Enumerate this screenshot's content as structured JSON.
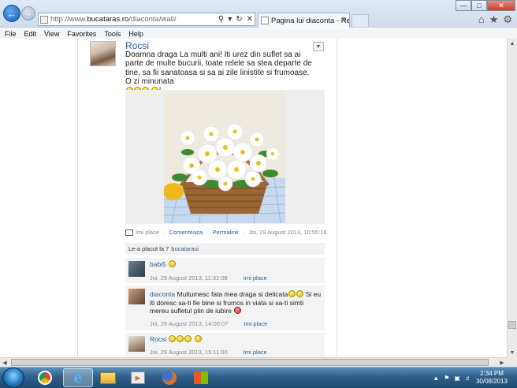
{
  "browser": {
    "url_prefix": "http://www.",
    "url_domain": "bucataras.ro",
    "url_path": "/diaconta/wall/",
    "tab_title": "Pagina lui diaconta - Retete...",
    "menu": [
      "File",
      "Edit",
      "View",
      "Favorites",
      "Tools",
      "Help"
    ]
  },
  "post": {
    "author": "Rocsi",
    "text": "Doamna draga La multi ani! Iti urez din suflet sa ai parte de multe bucurii, toate relele sa stea departe de tine, sa fii sanatoasa si sa ai zile linistite si frumoase. O zi minunata",
    "like_label": "Imi place",
    "comment_label": "Comenteaza",
    "permalink_label": "Permalink",
    "timestamp": "Joi, 29 August 2013, 10:55:16"
  },
  "likes": {
    "prefix": "Le-a placut la 7",
    "link": "bucatarasi"
  },
  "comments": [
    {
      "author": "babi5",
      "text": "",
      "timestamp": "Joi, 29 August 2013, 11:32:08",
      "like_label": "Imi place"
    },
    {
      "author": "diaconta",
      "text": "Multumesc fata mea draga si delicata",
      "text2": "Si eu iti doresc sa-ti fie bine si frumos in viata si sa-ti simti mereu sufletul plin de iubire",
      "timestamp": "Joi, 29 August 2013, 14:00:07",
      "like_label": "Imi place"
    },
    {
      "author": "Rocsi",
      "text": "",
      "timestamp": "Joi, 29 August 2013, 15:11:00",
      "like_label": "Imi place"
    }
  ],
  "taskbar": {
    "time": "2:34 PM",
    "date": "30/08/2013"
  },
  "colors": {
    "link": "#2b5fa0",
    "taskbar": "#2f5f8a",
    "close_button": "#c24130"
  }
}
